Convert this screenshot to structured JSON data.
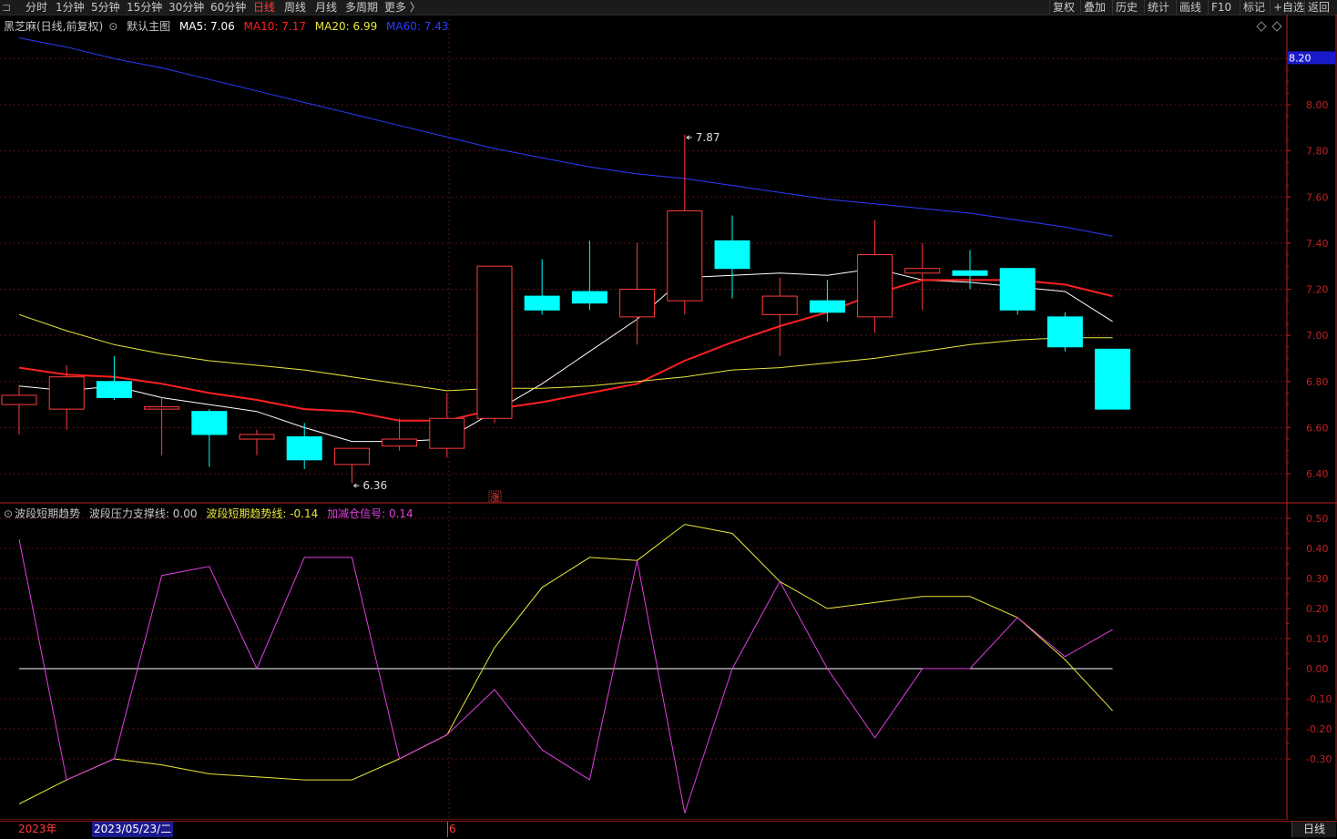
{
  "toolbar": {
    "periods": [
      "分时",
      "1分钟",
      "5分钟",
      "15分钟",
      "30分钟",
      "60分钟",
      "日线",
      "周线",
      "月线",
      "多周期",
      "更多 〉"
    ],
    "active_period": "日线",
    "right_buttons": [
      "复权",
      "叠加",
      "历史",
      "统计",
      "画线",
      "F10",
      "标记",
      "+自选",
      "返回"
    ]
  },
  "main_legend": {
    "stock": "黑芝麻(日线,前复权)",
    "chart_name": "默认主图",
    "ma5_label": "MA5:",
    "ma5_value": "7.06",
    "ma10_label": "MA10:",
    "ma10_value": "7.17",
    "ma20_label": "MA20:",
    "ma20_value": "6.99",
    "ma60_label": "MA60:",
    "ma60_value": "7.43"
  },
  "indicator_legend": {
    "name": "波段短期趋势",
    "support_label": "波段压力支撑线:",
    "support_value": "0.00",
    "trend_label": "波段短期趋势线:",
    "trend_value": "-0.14",
    "signal_label": "加减仓信号:",
    "signal_value": "0.14"
  },
  "colors": {
    "up": "#ff3c3c",
    "down": "#00ffff",
    "ma5": "#ffffff",
    "ma10": "#ff2020",
    "ma20": "#e8e83c",
    "ma60": "#2c3cff",
    "signal": "#e040e0",
    "trend": "#e8e83c",
    "axis": "#c02020"
  },
  "chart_data": [
    {
      "type": "candlestick",
      "title": "黑芝麻(日线,前复权)",
      "y_ticks": [
        "8.20",
        "8.00",
        "7.80",
        "7.60",
        "7.40",
        "7.20",
        "7.00",
        "6.80",
        "6.60",
        "6.40"
      ],
      "price_marker": "8.20",
      "annotations": [
        {
          "text": "7.87",
          "value": 7.87,
          "index": 14
        },
        {
          "text": "6.36",
          "value": 6.36,
          "index": 7
        }
      ],
      "up_marker": "涨",
      "candles": [
        {
          "o": 6.7,
          "c": 6.74,
          "h": 6.78,
          "l": 6.57
        },
        {
          "o": 6.68,
          "c": 6.82,
          "h": 6.87,
          "l": 6.59
        },
        {
          "o": 6.8,
          "c": 6.73,
          "h": 6.91,
          "l": 6.72
        },
        {
          "o": 6.68,
          "c": 6.69,
          "h": 6.73,
          "l": 6.48
        },
        {
          "o": 6.67,
          "c": 6.57,
          "h": 6.68,
          "l": 6.43
        },
        {
          "o": 6.55,
          "c": 6.57,
          "h": 6.59,
          "l": 6.48
        },
        {
          "o": 6.56,
          "c": 6.46,
          "h": 6.62,
          "l": 6.42
        },
        {
          "o": 6.44,
          "c": 6.51,
          "h": 6.51,
          "l": 6.36
        },
        {
          "o": 6.52,
          "c": 6.55,
          "h": 6.64,
          "l": 6.5
        },
        {
          "o": 6.51,
          "c": 6.64,
          "h": 6.75,
          "l": 6.47
        },
        {
          "o": 6.64,
          "c": 7.3,
          "h": 7.3,
          "l": 6.62
        },
        {
          "o": 7.17,
          "c": 7.11,
          "h": 7.33,
          "l": 7.09
        },
        {
          "o": 7.19,
          "c": 7.14,
          "h": 7.41,
          "l": 7.11
        },
        {
          "o": 7.08,
          "c": 7.2,
          "h": 7.4,
          "l": 6.96
        },
        {
          "o": 7.15,
          "c": 7.54,
          "h": 7.87,
          "l": 7.09
        },
        {
          "o": 7.41,
          "c": 7.29,
          "h": 7.52,
          "l": 7.16
        },
        {
          "o": 7.09,
          "c": 7.17,
          "h": 7.25,
          "l": 6.91
        },
        {
          "o": 7.15,
          "c": 7.1,
          "h": 7.24,
          "l": 7.06
        },
        {
          "o": 7.08,
          "c": 7.35,
          "h": 7.5,
          "l": 7.01
        },
        {
          "o": 7.27,
          "c": 7.29,
          "h": 7.4,
          "l": 7.11
        },
        {
          "o": 7.28,
          "c": 7.26,
          "h": 7.37,
          "l": 7.2
        },
        {
          "o": 7.29,
          "c": 7.11,
          "h": 7.29,
          "l": 7.09
        },
        {
          "o": 7.08,
          "c": 6.95,
          "h": 7.1,
          "l": 6.93
        },
        {
          "o": 6.94,
          "c": 6.68,
          "h": 6.94,
          "l": 6.68
        }
      ],
      "series": [
        {
          "name": "MA5",
          "values": [
            6.78,
            6.76,
            6.78,
            6.73,
            6.7,
            6.67,
            6.6,
            6.54,
            6.54,
            6.55,
            6.67,
            6.79,
            6.93,
            7.07,
            7.25,
            7.26,
            7.27,
            7.26,
            7.29,
            7.24,
            7.23,
            7.21,
            7.19,
            7.06
          ]
        },
        {
          "name": "MA10",
          "values": [
            6.86,
            6.83,
            6.82,
            6.79,
            6.75,
            6.72,
            6.68,
            6.67,
            6.63,
            6.63,
            6.68,
            6.71,
            6.75,
            6.79,
            6.89,
            6.97,
            7.04,
            7.1,
            7.18,
            7.24,
            7.24,
            7.24,
            7.22,
            7.17
          ]
        },
        {
          "name": "MA20",
          "values": [
            7.09,
            7.02,
            6.96,
            6.92,
            6.89,
            6.87,
            6.85,
            6.82,
            6.79,
            6.76,
            6.77,
            6.77,
            6.78,
            6.8,
            6.82,
            6.85,
            6.86,
            6.88,
            6.9,
            6.93,
            6.96,
            6.98,
            6.99,
            6.99
          ]
        },
        {
          "name": "MA60",
          "values": [
            8.29,
            8.25,
            8.2,
            8.16,
            8.11,
            8.06,
            8.01,
            7.96,
            7.91,
            7.86,
            7.81,
            7.77,
            7.73,
            7.7,
            7.68,
            7.65,
            7.62,
            7.59,
            7.57,
            7.55,
            7.53,
            7.5,
            7.47,
            7.43
          ]
        }
      ]
    },
    {
      "type": "line",
      "title": "波段短期趋势",
      "y_ticks": [
        "0.50",
        "0.40",
        "0.30",
        "0.20",
        "0.10",
        "0.00",
        "-0.10",
        "-0.20",
        "-0.30"
      ],
      "series": [
        {
          "name": "波段压力支撑线",
          "values": [
            0,
            0,
            0,
            0,
            0,
            0,
            0,
            0,
            0,
            0,
            0,
            0,
            0,
            0,
            0,
            0,
            0,
            0,
            0,
            0,
            0,
            0,
            0,
            0
          ]
        },
        {
          "name": "波段短期趋势线",
          "values": [
            -0.45,
            -0.37,
            -0.3,
            -0.32,
            -0.35,
            -0.36,
            -0.37,
            -0.37,
            -0.3,
            -0.22,
            0.07,
            0.27,
            0.37,
            0.36,
            0.48,
            0.45,
            0.29,
            0.2,
            0.22,
            0.24,
            0.24,
            0.17,
            0.03,
            -0.14
          ]
        },
        {
          "name": "加减仓信号",
          "values": [
            0.43,
            -0.37,
            -0.3,
            0.31,
            0.34,
            0.0,
            0.37,
            0.37,
            -0.3,
            -0.22,
            -0.07,
            -0.27,
            -0.37,
            0.36,
            -0.48,
            0.0,
            0.29,
            0.0,
            -0.23,
            0.0,
            0.0,
            0.17,
            0.04,
            0.13
          ]
        }
      ]
    }
  ],
  "date_bar": {
    "year": "2023年",
    "cursor_date": "2023/05/23/二",
    "month_mark": "6",
    "period_button": "日线"
  }
}
